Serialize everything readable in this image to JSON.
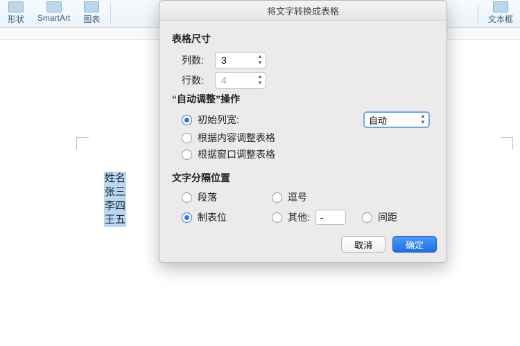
{
  "ribbon": {
    "shape": "形状",
    "smartart": "SmartArt",
    "chart": "图表",
    "textbox": "文本框"
  },
  "document": {
    "selected_lines": [
      "姓名",
      "张三",
      "李四",
      "王五"
    ]
  },
  "dialog": {
    "title": "将文字转换成表格",
    "section_size": "表格尺寸",
    "cols_label": "列数:",
    "cols_value": "3",
    "rows_label": "行数:",
    "rows_value": "4",
    "section_autofit": "“自动调整”操作",
    "autofit_initial": "初始列宽:",
    "autofit_value": "自动",
    "autofit_content": "根据内容调整表格",
    "autofit_window": "根据窗口调整表格",
    "section_sep": "文字分隔位置",
    "sep_paragraph": "段落",
    "sep_comma": "逗号",
    "sep_tab": "制表位",
    "sep_other": "其他:",
    "sep_other_value": "-",
    "sep_spacing": "间距",
    "cancel": "取消",
    "ok": "确定"
  }
}
